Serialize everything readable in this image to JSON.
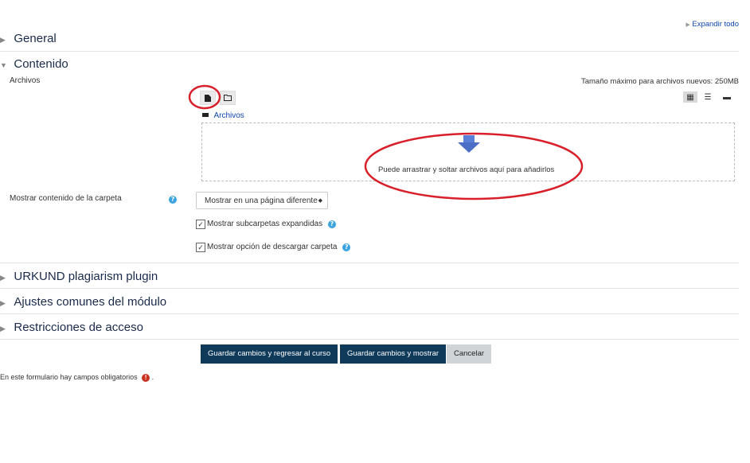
{
  "expand_all": "Expandir todo",
  "sections": {
    "general": "General",
    "contenido": "Contenido",
    "urkund": "URKUND plagiarism plugin",
    "ajustes": "Ajustes comunes del módulo",
    "restricciones": "Restricciones de acceso"
  },
  "files": {
    "label": "Archivos",
    "max_size": "Tamaño máximo para archivos nuevos: 250MB",
    "folder_link": "Archivos",
    "drop_text": "Puede arrastrar y soltar archivos aquí para añadirlos"
  },
  "display": {
    "label": "Mostrar contenido de la carpeta",
    "selected": "Mostrar en una página diferente",
    "checkbox_subfolders": "Mostrar subcarpetas expandidas",
    "checkbox_download": "Mostrar opción de descargar carpeta"
  },
  "buttons": {
    "save_return": "Guardar cambios y regresar al curso",
    "save_show": "Guardar cambios y mostrar",
    "cancel": "Cancelar"
  },
  "required_note": "En este formulario hay campos obligatorios",
  "colors": {
    "annotation": "#d9202a",
    "primary_button": "#0f3a5a",
    "arrow": "#5a7fd6"
  }
}
